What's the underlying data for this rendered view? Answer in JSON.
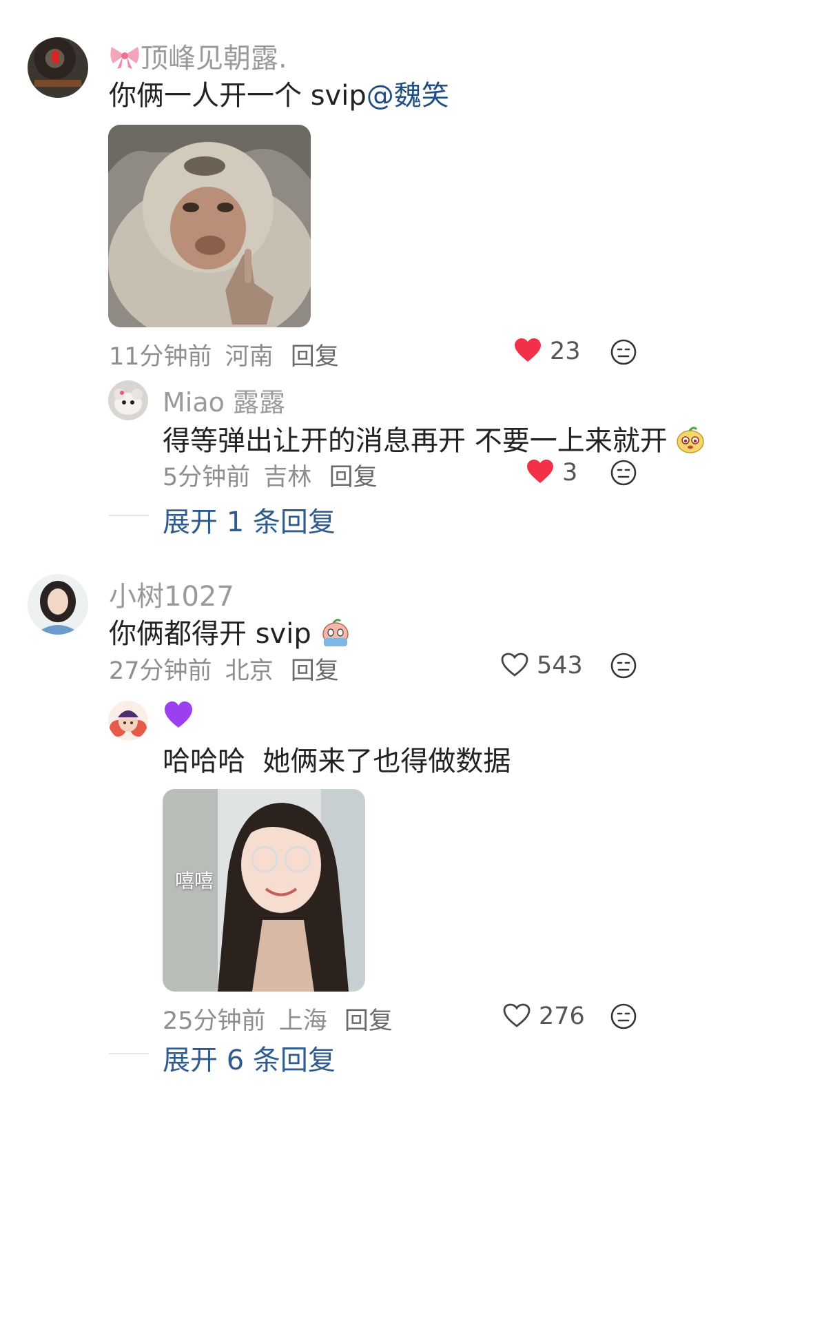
{
  "comments": [
    {
      "username": "顶峰见朝露.",
      "username_prefix_icon": "bow-icon",
      "text": "你俩一人开一个 svip",
      "mention": "@魏笑",
      "image": "monkey-meme",
      "time": "11分钟前",
      "location": "河南",
      "reply_label": "回复",
      "likes": "23",
      "liked": true,
      "replies": [
        {
          "username": "Miao 露露",
          "text": "得等弹出让开的消息再开 不要一上来就开",
          "emoji": "cute-face-emoji",
          "time": "5分钟前",
          "location": "吉林",
          "reply_label": "回复",
          "likes": "3",
          "liked": true
        }
      ],
      "expand_label": "展开 1 条回复"
    },
    {
      "username": "小树1027",
      "text": "你俩都得开 svip",
      "emoji": "crying-face-emoji",
      "time": "27分钟前",
      "location": "北京",
      "reply_label": "回复",
      "likes": "543",
      "liked": false,
      "replies": [
        {
          "username_icon": "purple-heart-icon",
          "text": "哈哈哈  她俩来了也得做数据",
          "image_caption": "嘻嘻",
          "time": "25分钟前",
          "location": "上海",
          "reply_label": "回复",
          "likes": "276",
          "liked": false
        }
      ],
      "expand_label": "展开 6 条回复"
    }
  ],
  "colors": {
    "liked_heart": "#f23048",
    "link": "#2f5b8f",
    "meta": "#8e8e8e",
    "purple_heart": "#9b3ff0"
  }
}
